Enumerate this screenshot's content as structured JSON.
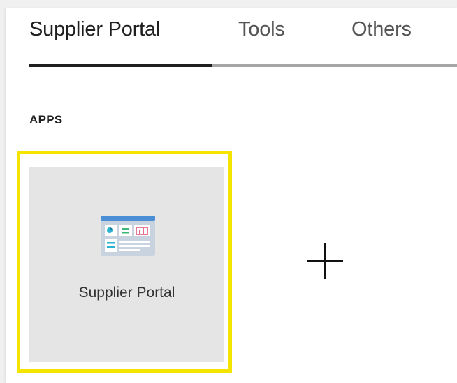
{
  "tabs": [
    {
      "label": "Supplier Portal",
      "active": true
    },
    {
      "label": "Tools",
      "active": false
    },
    {
      "label": "Others",
      "active": false
    }
  ],
  "section": {
    "title": "APPS"
  },
  "apps": [
    {
      "label": "Supplier Portal",
      "icon": "app-window-icon"
    }
  ],
  "add_tile": {
    "icon": "plus-icon"
  },
  "colors": {
    "highlight": "#f5e400",
    "tile_background": "#e5e5e5",
    "tab_active_indicator": "#1f1f1f",
    "tab_rail": "#a6a6a6",
    "icon_header": "#4a8fd6",
    "icon_accent_cyan": "#2bb3d1",
    "icon_accent_green": "#3cb878",
    "icon_accent_pink": "#e36c8a"
  }
}
